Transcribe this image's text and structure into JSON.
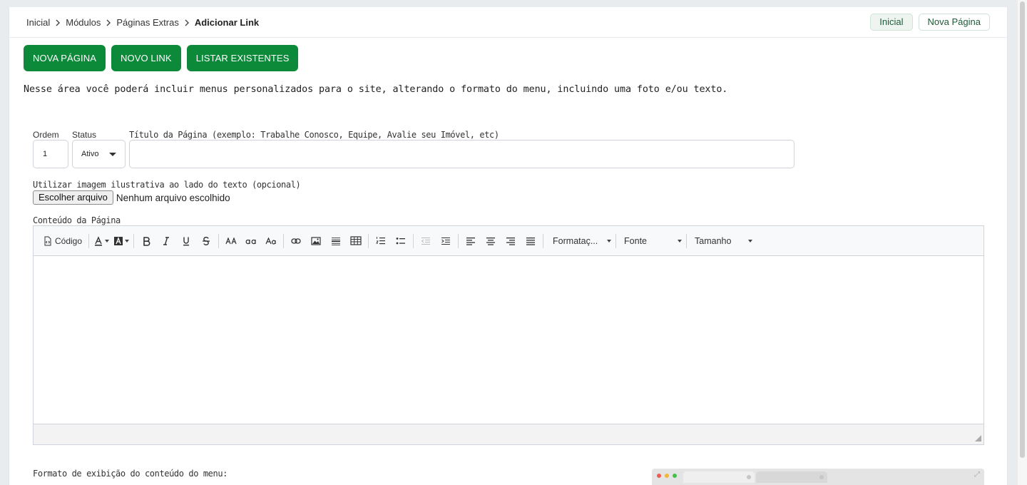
{
  "breadcrumb": {
    "items": [
      "Inicial",
      "Módulos",
      "Páginas Extras"
    ],
    "current": "Adicionar Link"
  },
  "top_actions": {
    "home": "Inicial",
    "new_page": "Nova Página"
  },
  "actions": {
    "new_page": "NOVA PÁGINA",
    "new_link": "NOVO LINK",
    "list": "LISTAR EXISTENTES"
  },
  "intro_text": "Nesse área você poderá incluir menus personalizados para o site, alterando o formato do menu, incluindo uma foto e/ou texto.",
  "form": {
    "order": {
      "label": "Ordem",
      "value": "1"
    },
    "status": {
      "label": "Status",
      "value": "Ativo"
    },
    "title": {
      "label": "Título da Página (exemplo: Trabalhe Conosco, Equipe, Avalie seu Imóvel, etc)",
      "value": ""
    },
    "image": {
      "label": "Utilizar imagem ilustrativa ao lado do texto (opcional)",
      "button": "Escolher arquivo",
      "status": "Nenhum arquivo escolhido"
    },
    "content": {
      "label": "Conteúdo da Página"
    },
    "menu_format": {
      "label": "Formato de exibição do conteúdo do menu:"
    }
  },
  "editor": {
    "code_label": "Código",
    "format_label": "Formataç...",
    "font_label": "Fonte",
    "size_label": "Tamanho"
  },
  "colors": {
    "primary": "#0c8a3a",
    "pill_text": "#1e5a38"
  }
}
